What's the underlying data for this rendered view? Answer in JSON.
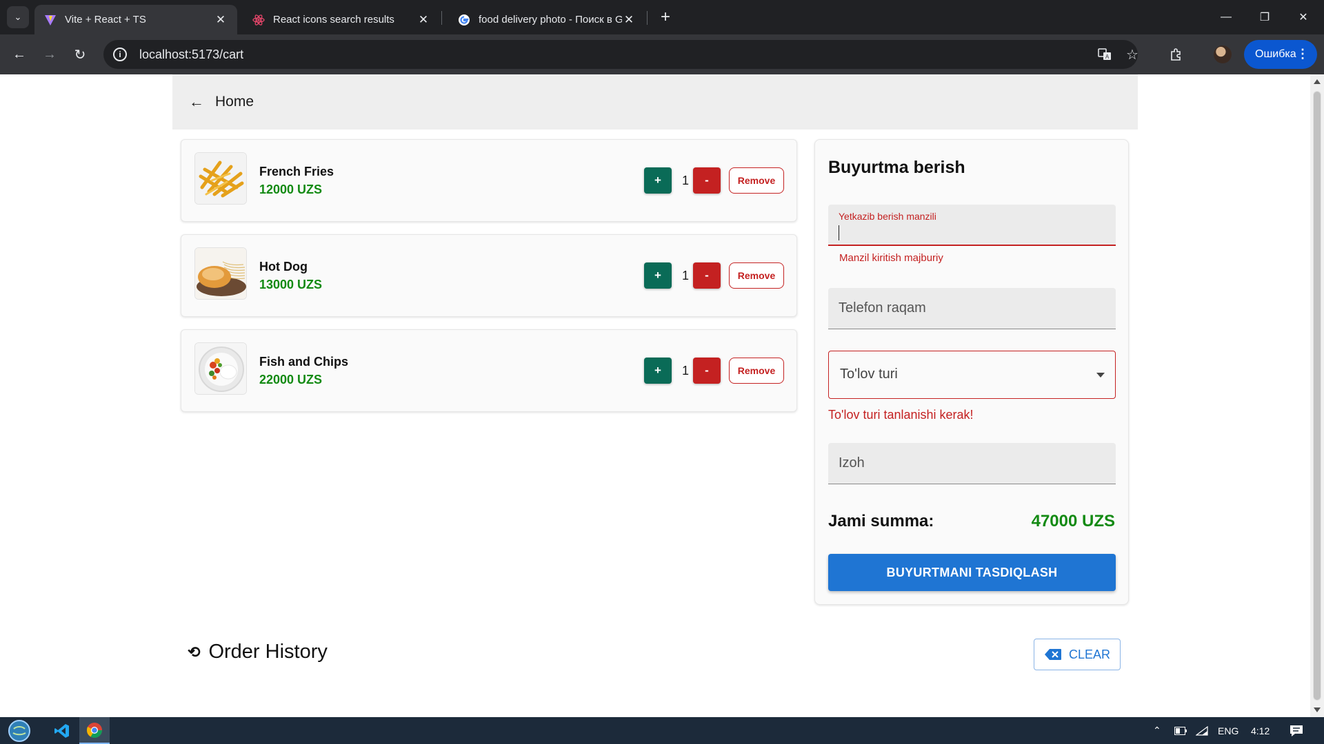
{
  "browser": {
    "tabs": [
      {
        "title": "Vite + React + TS",
        "icon": "vite-icon",
        "active": true
      },
      {
        "title": "React icons search results",
        "icon": "react-icon",
        "active": false
      },
      {
        "title": "food delivery photo - Поиск в Google",
        "icon": "google-icon",
        "active": false
      }
    ],
    "new_tab": "+",
    "url": "localhost:5173/cart",
    "profile_error": "Ошибка"
  },
  "header": {
    "back_icon": "arrow-left-icon",
    "home_label": "Home"
  },
  "cart": {
    "items": [
      {
        "name": "French Fries",
        "price": "12000 UZS",
        "qty": "1",
        "image": "french-fries-image"
      },
      {
        "name": "Hot Dog",
        "price": "13000 UZS",
        "qty": "1",
        "image": "hot-dog-image"
      },
      {
        "name": "Fish and Chips",
        "price": "22000 UZS",
        "qty": "1",
        "image": "fish-and-chips-image"
      }
    ],
    "plus_label": "+",
    "minus_label": "-",
    "remove_label": "Remove"
  },
  "order": {
    "title": "Buyurtma berish",
    "address": {
      "label": "Yetkazib berish manzili",
      "value": "",
      "error": "Manzil kiritish majburiy"
    },
    "phone": {
      "placeholder": "Telefon raqam"
    },
    "payment": {
      "placeholder": "To'lov turi",
      "error": "To'lov turi tanlanishi kerak!"
    },
    "note": {
      "placeholder": "Izoh"
    },
    "total_label": "Jami summa:",
    "total_value": "47000 UZS",
    "confirm_label": "BUYURTMANI TASDIQLASH"
  },
  "history": {
    "title": "Order History",
    "icon": "history-icon",
    "clear_label": "CLEAR",
    "clear_icon": "backspace-icon"
  },
  "taskbar": {
    "language": "ENG",
    "time": "4:12"
  },
  "colors": {
    "accent_blue": "#1f75d3",
    "price_green": "#138a13",
    "plus_green": "#0a6b57",
    "danger_red": "#c42121"
  }
}
